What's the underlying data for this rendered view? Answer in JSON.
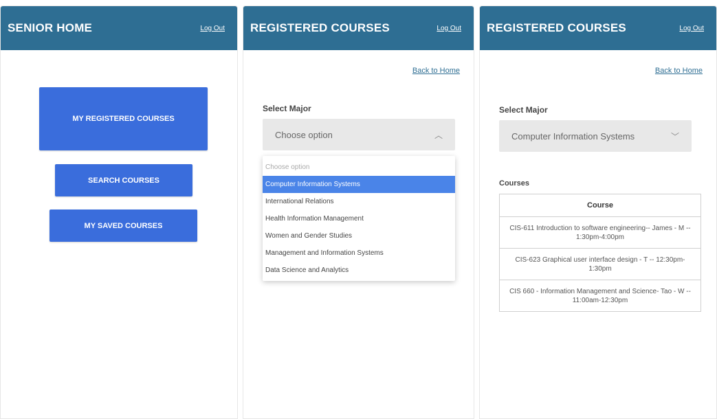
{
  "screen1": {
    "title": "SENIOR HOME",
    "logout": "Log Out",
    "buttons": [
      "MY REGISTERED COURSES",
      "SEARCH COURSES",
      "MY SAVED COURSES"
    ]
  },
  "screen2": {
    "title": "REGISTERED COURSES",
    "logout": "Log Out",
    "back": "Back to Home",
    "select_label": "Select Major",
    "select_value": "Choose option",
    "options": [
      "Choose option",
      "Computer Information Systems",
      "International Relations",
      "Health Information Management",
      "Women and Gender Studies",
      "Management and Information Systems",
      "Data Science and Analytics"
    ],
    "highlighted_option": "Computer Information Systems"
  },
  "screen3": {
    "title": "REGISTERED COURSES",
    "logout": "Log Out",
    "back": "Back to Home",
    "select_label": "Select Major",
    "select_value": "Computer Information Systems",
    "courses_label": "Courses",
    "table_header": "Course",
    "courses": [
      "CIS-611 Introduction to software engineering-- James - M -- 1:30pm-4:00pm",
      "CIS-623 Graphical user interface design - T -- 12:30pm-1:30pm",
      "CIS 660 - Information Management and Science- Tao - W -- 11:00am-12:30pm"
    ]
  },
  "colors": {
    "header": "#2e6e93",
    "button": "#3a6ddc",
    "highlight": "#4a84e8",
    "select_bg": "#e8e8e8"
  },
  "icons": {
    "chevron_up": "chevron-up-icon",
    "chevron_down": "chevron-down-icon"
  }
}
